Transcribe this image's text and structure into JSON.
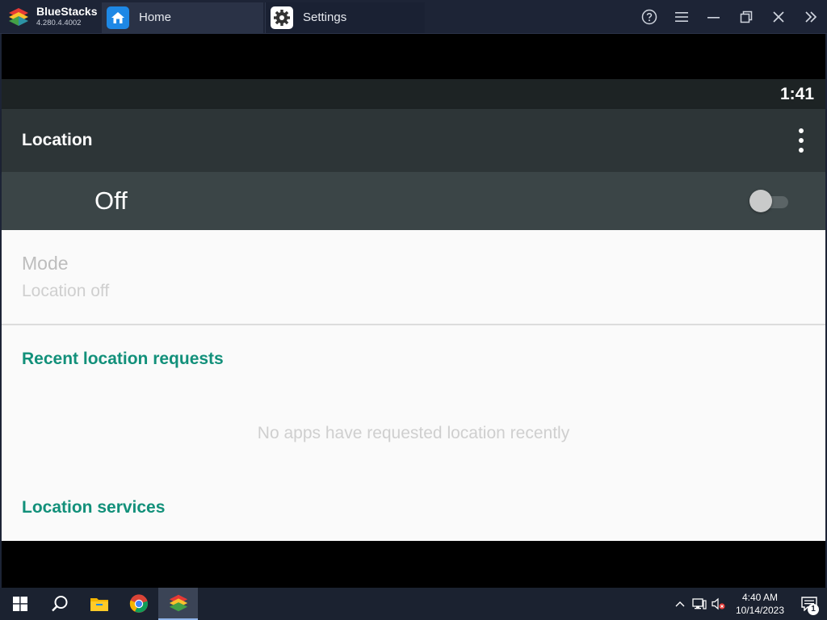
{
  "titlebar": {
    "app_name": "BlueStacks",
    "version": "4.280.4.4002",
    "tabs": [
      {
        "label": "Home",
        "icon": "home-icon"
      },
      {
        "label": "Settings",
        "icon": "gear-icon"
      }
    ],
    "controls": [
      "help-icon",
      "menu-icon",
      "minimize-icon",
      "restore-icon",
      "close-icon",
      "expand-sidebar-icon"
    ]
  },
  "android": {
    "status_time": "1:41",
    "appbar_title": "Location",
    "master_switch": {
      "label": "Off",
      "state": false
    },
    "mode": {
      "title": "Mode",
      "subtitle": "Location off"
    },
    "recent_requests": {
      "title": "Recent location requests",
      "empty_message": "No apps have requested location recently"
    },
    "services_title": "Location services",
    "accent_color": "#12907a"
  },
  "taskbar": {
    "apps": [
      "start-icon",
      "search-icon",
      "file-explorer-icon",
      "chrome-icon",
      "bluestacks-icon"
    ],
    "clock_time": "4:40 AM",
    "clock_date": "10/14/2023",
    "notification_count": "1"
  }
}
